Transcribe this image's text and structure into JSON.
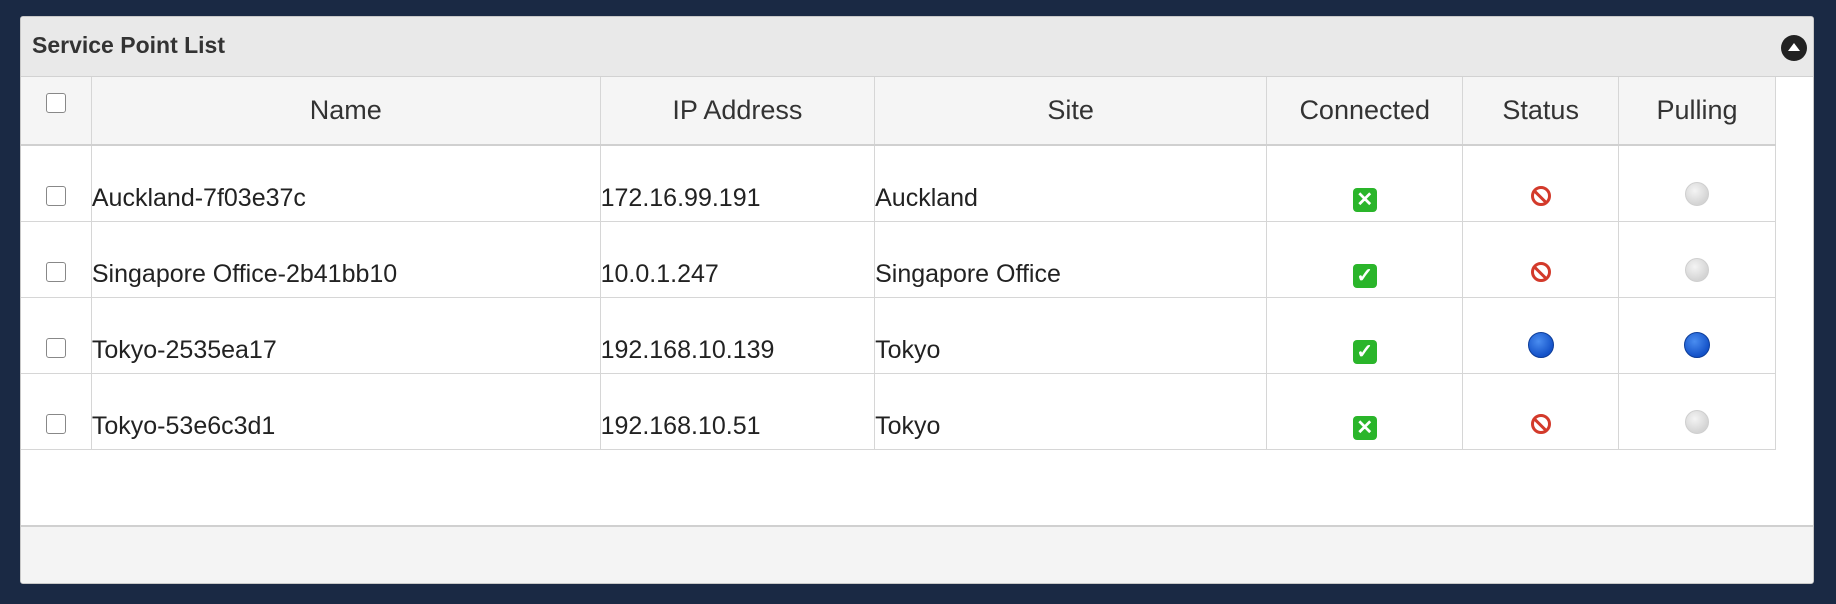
{
  "panel": {
    "title": "Service Point List"
  },
  "columns": [
    "Name",
    "IP Address",
    "Site",
    "Connected",
    "Status",
    "Pulling"
  ],
  "rows": [
    {
      "name": "Auckland-7f03e37c",
      "ip": "172.16.99.191",
      "site": "Auckland",
      "connected": "no",
      "status": "blocked",
      "pulling": "idle"
    },
    {
      "name": "Singapore Office-2b41bb10",
      "ip": "10.0.1.247",
      "site": "Singapore Office",
      "connected": "yes",
      "status": "blocked",
      "pulling": "idle"
    },
    {
      "name": "Tokyo-2535ea17",
      "ip": "192.168.10.139",
      "site": "Tokyo",
      "connected": "yes",
      "status": "active",
      "pulling": "active"
    },
    {
      "name": "Tokyo-53e6c3d1",
      "ip": "192.168.10.51",
      "site": "Tokyo",
      "connected": "no",
      "status": "blocked",
      "pulling": "idle"
    }
  ],
  "icons": {
    "connected_yes": "check-icon",
    "connected_no": "x-icon",
    "status_blocked": "forbidden-icon",
    "active": "blue-dot-icon",
    "idle": "grey-dot-icon",
    "collapse": "collapse-up-icon"
  },
  "colors": {
    "background": "#1a2944",
    "green": "#2ab52a",
    "red": "#d33a2b",
    "blue": "#1452c8"
  }
}
